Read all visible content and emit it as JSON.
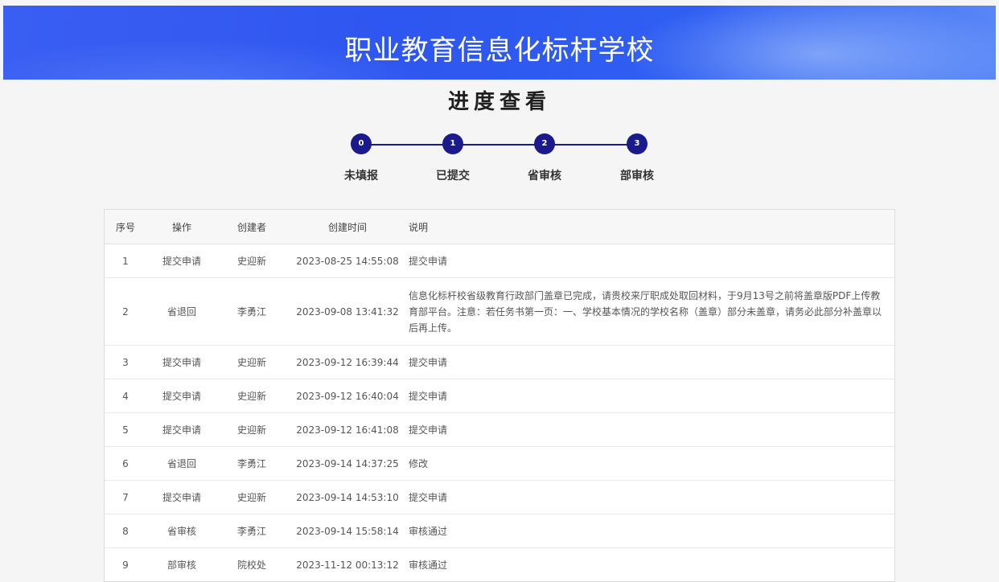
{
  "banner": {
    "title": "职业教育信息化标杆学校"
  },
  "page_title": "进度查看",
  "steps": [
    {
      "num": "0",
      "label": "未填报"
    },
    {
      "num": "1",
      "label": "已提交"
    },
    {
      "num": "2",
      "label": "省审核"
    },
    {
      "num": "3",
      "label": "部审核"
    }
  ],
  "table": {
    "headers": {
      "no": "序号",
      "op": "操作",
      "by": "创建者",
      "time": "创建时间",
      "note": "说明"
    },
    "rows": [
      {
        "no": "1",
        "op": "提交申请",
        "by": "史迎新",
        "time": "2023-08-25 14:55:08",
        "note": "提交申请"
      },
      {
        "no": "2",
        "op": "省退回",
        "by": "李勇江",
        "time": "2023-09-08 13:41:32",
        "note": "信息化标杆校省级教育行政部门盖章已完成，请贵校来厅职成处取回材料，于9月13号之前将盖章版PDF上传教育部平台。注意：若任务书第一页：一、学校基本情况的学校名称（盖章）部分未盖章，请务必此部分补盖章以后再上传。"
      },
      {
        "no": "3",
        "op": "提交申请",
        "by": "史迎新",
        "time": "2023-09-12 16:39:44",
        "note": "提交申请"
      },
      {
        "no": "4",
        "op": "提交申请",
        "by": "史迎新",
        "time": "2023-09-12 16:40:04",
        "note": "提交申请"
      },
      {
        "no": "5",
        "op": "提交申请",
        "by": "史迎新",
        "time": "2023-09-12 16:41:08",
        "note": "提交申请"
      },
      {
        "no": "6",
        "op": "省退回",
        "by": "李勇江",
        "time": "2023-09-14 14:37:25",
        "note": "修改"
      },
      {
        "no": "7",
        "op": "提交申请",
        "by": "史迎新",
        "time": "2023-09-14 14:53:10",
        "note": "提交申请"
      },
      {
        "no": "8",
        "op": "省审核",
        "by": "李勇江",
        "time": "2023-09-14 15:58:14",
        "note": "审核通过"
      },
      {
        "no": "9",
        "op": "部审核",
        "by": "院校处",
        "time": "2023-11-12 00:13:12",
        "note": "审核通过"
      }
    ]
  },
  "colors": {
    "banner": "#2e56f0",
    "step_accent": "#1a1a8c"
  }
}
